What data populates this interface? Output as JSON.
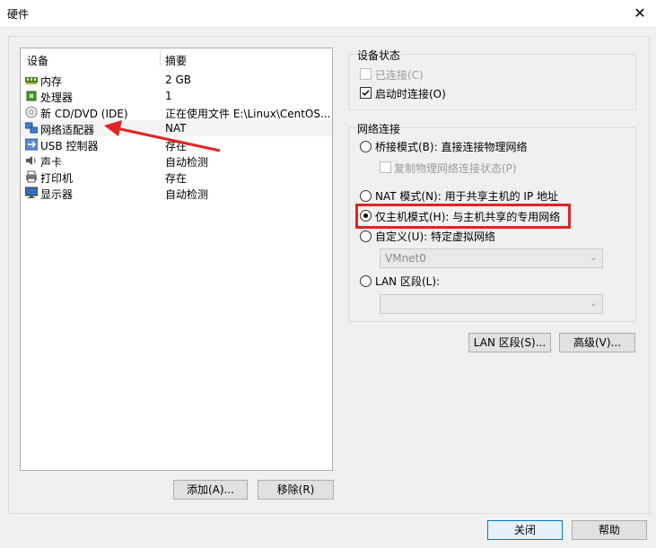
{
  "window": {
    "title": "硬件",
    "close_glyph": "✕"
  },
  "device_list": {
    "col_device": "设备",
    "col_summary": "摘要",
    "rows": [
      {
        "name": "内存",
        "value": "2 GB",
        "icon": "memory-icon"
      },
      {
        "name": "处理器",
        "value": "1",
        "icon": "cpu-icon"
      },
      {
        "name": "新 CD/DVD (IDE)",
        "value": "正在使用文件 E:\\Linux\\CentOS...",
        "icon": "cd-icon"
      },
      {
        "name": "网络适配器",
        "value": "NAT",
        "icon": "network-icon"
      },
      {
        "name": "USB 控制器",
        "value": "存在",
        "icon": "usb-icon"
      },
      {
        "name": "声卡",
        "value": "自动检测",
        "icon": "sound-icon"
      },
      {
        "name": "打印机",
        "value": "存在",
        "icon": "printer-icon"
      },
      {
        "name": "显示器",
        "value": "自动检测",
        "icon": "monitor-icon"
      }
    ],
    "selected_index": 3
  },
  "buttons": {
    "add": "添加(A)...",
    "remove": "移除(R)",
    "lan_segments": "LAN 区段(S)...",
    "advanced": "高级(V)...",
    "close": "关闭",
    "help": "帮助"
  },
  "device_status": {
    "title": "设备状态",
    "connected": "已连接(C)",
    "connect_on_power_on": "启动时连接(O)",
    "connected_checked": false,
    "connect_on_power_on_checked": true
  },
  "network_connection": {
    "title": "网络连接",
    "bridged": "桥接模式(B): 直接连接物理网络",
    "replicate_state": "复制物理网络连接状态(P)",
    "nat": "NAT 模式(N): 用于共享主机的 IP 地址",
    "host_only": "仅主机模式(H): 与主机共享的专用网络",
    "custom": "自定义(U): 特定虚拟网络",
    "custom_select_value": "VMnet0",
    "lan_segment": "LAN 区段(L):",
    "lan_select_value": "",
    "selected": "host_only"
  },
  "colors": {
    "annotation_red": "#e02424",
    "primary_border": "#0078d7"
  }
}
